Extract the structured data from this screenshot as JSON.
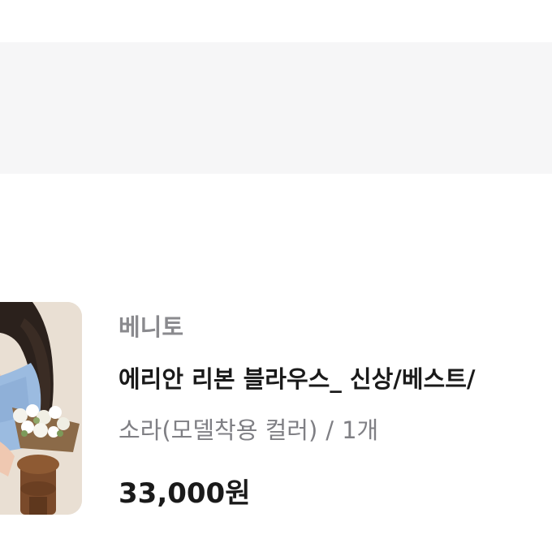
{
  "product": {
    "brand": "베니토",
    "title": "에리안 리본 블라우스_ 신상/베스트/",
    "option_color": "소라(모델착용 컬러)",
    "option_separator": "/",
    "option_quantity": "1개",
    "price": "33,000원",
    "thumbnail_icon": "product-photo"
  },
  "colors": {
    "top_band": "#f6f6f7",
    "brand_text": "#8a8a8e",
    "title_text": "#1a1a1a",
    "option_text": "#7f7f84"
  }
}
